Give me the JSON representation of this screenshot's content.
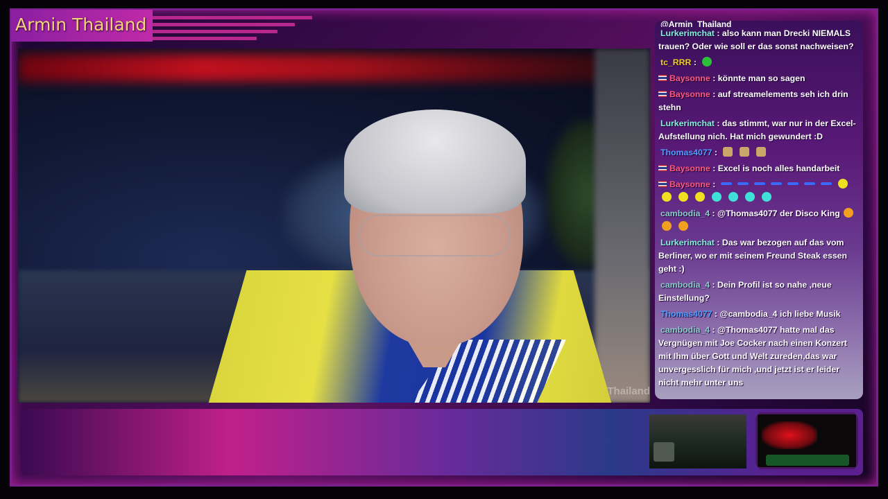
{
  "overlay": {
    "streamer_name": "Armin Thailand",
    "webcam_watermark": "Thailand"
  },
  "chat": {
    "top_partial": "@Armin_Thailand",
    "messages": [
      {
        "user": "Lurkerimchat",
        "user_color": "#7ff5d8",
        "flag": false,
        "text": "also kann man Drecki NIEMALS trauen? Oder wie soll er das sonst nachweisen?",
        "emotes": []
      },
      {
        "user": "tc_RRR",
        "user_color": "#f0d020",
        "flag": false,
        "text": "",
        "emotes": [
          "green"
        ]
      },
      {
        "user": "Baysonne",
        "user_color": "#ff5a7a",
        "flag": true,
        "text": "könnte man so sagen",
        "emotes": []
      },
      {
        "user": "Baysonne",
        "user_color": "#ff5a7a",
        "flag": true,
        "text": "auf streamelements seh ich drin stehn",
        "emotes": []
      },
      {
        "user": "Lurkerimchat",
        "user_color": "#7ff5d8",
        "flag": false,
        "text": "das stimmt, war nur in der Excel-Aufstellung nich. Hat mich gewundert :D",
        "emotes": []
      },
      {
        "user": "Thomas4077",
        "user_color": "#4aa0ff",
        "flag": false,
        "text": "",
        "emotes": [
          "idol",
          "idol",
          "idol"
        ]
      },
      {
        "user": "Baysonne",
        "user_color": "#ff5a7a",
        "flag": true,
        "text": "Excel is noch alles handarbeit",
        "emotes": []
      },
      {
        "user": "Baysonne",
        "user_color": "#ff5a7a",
        "flag": true,
        "text": "",
        "emotes": [
          "wavy",
          "wavy",
          "wavy",
          "wavy",
          "wavy",
          "wavy",
          "wavy",
          "pac",
          "pac",
          "pac",
          "pac",
          "cyan",
          "cyan",
          "cyan",
          "cyan"
        ]
      },
      {
        "user": "cambodia_4",
        "user_color": "#8ad0c8",
        "flag": false,
        "text": "@Thomas4077 der Disco King",
        "emotes": [
          "smile",
          "smile",
          "smile"
        ]
      },
      {
        "user": "Lurkerimchat",
        "user_color": "#7ff5d8",
        "flag": false,
        "text": "Das war bezogen auf das vom Berliner, wo er mit seinem Freund Steak essen geht :)",
        "emotes": []
      },
      {
        "user": "cambodia_4",
        "user_color": "#8ad0c8",
        "flag": false,
        "text": "Dein Profil ist so nahe ,neue Einstellung?",
        "emotes": []
      },
      {
        "user": "Thomas4077",
        "user_color": "#4aa0ff",
        "flag": false,
        "text": "@cambodia_4 ich liebe Musik",
        "emotes": []
      },
      {
        "user": "cambodia_4",
        "user_color": "#8ad0c8",
        "flag": false,
        "text": "@Thomas4077 hatte mal das Vergnügen mit Joe Cocker nach einen Konzert mit Ihm über Gott und Welt zureden,das war unvergesslich für mich ,und jetzt ist er leider nicht mehr unter uns",
        "emotes": []
      }
    ]
  }
}
